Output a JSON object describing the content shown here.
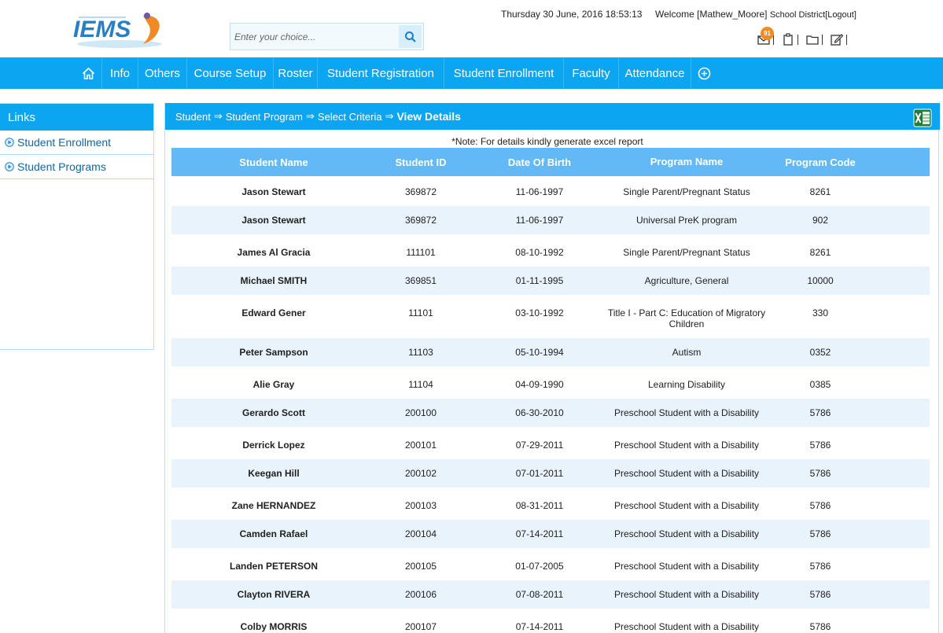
{
  "header": {
    "datetime": "Thursday 30 June, 2016 18:53:13",
    "welcome_prefix": "Welcome [Mathew_Moore]",
    "district": "School District",
    "logout": "[Logout]",
    "notification_count": "91"
  },
  "search": {
    "placeholder": "Enter your choice..."
  },
  "nav": {
    "items": [
      "Info",
      "Others",
      "Course Setup",
      "Roster",
      "Student Registration",
      "Student Enrollment",
      "Faculty",
      "Attendance"
    ]
  },
  "sidebar": {
    "title": "Links",
    "items": [
      "Student Enrollment",
      "Student Programs"
    ]
  },
  "breadcrumb": {
    "items": [
      "Student",
      "Student Program",
      "Select Criteria"
    ],
    "separator": "⇒",
    "current": "View Details"
  },
  "note": "*Note: For details kindly generate excel report",
  "table": {
    "columns": [
      "Student Name",
      "Student ID",
      "Date Of Birth",
      "Program Name",
      "Program Code"
    ],
    "rows": [
      [
        "Jason Stewart",
        "369872",
        "11-06-1997",
        "Single Parent/Pregnant Status",
        "8261"
      ],
      [
        "Jason Stewart",
        "369872",
        "11-06-1997",
        "Universal PreK program",
        "902"
      ],
      [
        "James Al Gracia",
        "111101",
        "08-10-1992",
        "Single Parent/Pregnant Status",
        "8261"
      ],
      [
        "Michael SMITH",
        "369851",
        "01-11-1995",
        "Agriculture, General",
        "10000"
      ],
      [
        "Edward Gener",
        "11101",
        "03-10-1992",
        "Title I - Part C: Education of Migratory Children",
        "330"
      ],
      [
        "Peter Sampson",
        "11103",
        "05-10-1994",
        "Autism",
        "0352"
      ],
      [
        "Alie Gray",
        "11104",
        "04-09-1990",
        "Learning Disability",
        "0385"
      ],
      [
        "Gerardo Scott",
        "200100",
        "06-30-2010",
        "Preschool Student with a Disability",
        "5786"
      ],
      [
        "Derrick Lopez",
        "200101",
        "07-29-2011",
        "Preschool Student with a Disability",
        "5786"
      ],
      [
        "Keegan Hill",
        "200102",
        "07-01-2011",
        "Preschool Student with a Disability",
        "5786"
      ],
      [
        "Zane HERNANDEZ",
        "200103",
        "08-31-2011",
        "Preschool Student with a Disability",
        "5786"
      ],
      [
        "Camden Rafael",
        "200104",
        "07-14-2011",
        "Preschool Student with a Disability",
        "5786"
      ],
      [
        "Landen PETERSON",
        "200105",
        "01-07-2005",
        "Preschool Student with a Disability",
        "5786"
      ],
      [
        "Clayton RIVERA",
        "200106",
        "07-08-2011",
        "Preschool Student with a Disability",
        "5786"
      ],
      [
        "Colby MORRIS",
        "200107",
        "07-14-2011",
        "Preschool Student with a Disability",
        "5786"
      ]
    ]
  },
  "colors": {
    "nav_bg": "#0ca5f1",
    "table_header_bg": "#62b9f5",
    "alt_row_bg": "#e9f3fc",
    "link_color": "#1266a6",
    "badge": "#f58a1f"
  },
  "icons": [
    "iems-logo",
    "search-icon",
    "home-icon",
    "plus-circle-icon",
    "mail-icon",
    "clipboard-icon",
    "folder-icon",
    "edit-icon",
    "excel-icon",
    "bullet-arrow-icon"
  ]
}
